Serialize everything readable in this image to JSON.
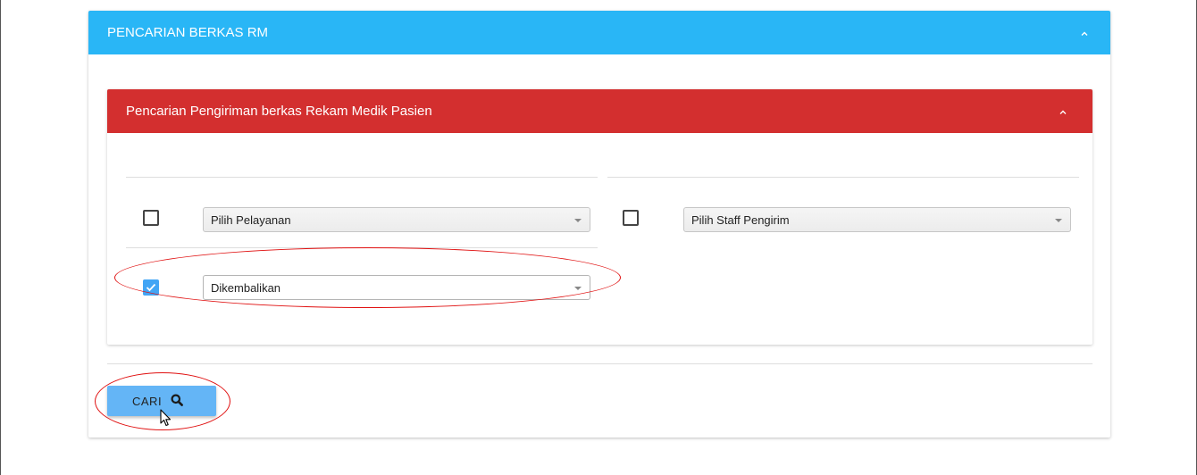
{
  "outer_panel": {
    "title": "PENCARIAN BERKAS RM",
    "collapse_icon": "chevron-up-icon"
  },
  "inner_panel": {
    "title": "Pencarian Pengiriman berkas Rekam Medik Pasien",
    "collapse_icon": "chevron-up-icon"
  },
  "filters": {
    "pelayanan": {
      "checked": false,
      "selected": "Pilih Pelayanan"
    },
    "staff": {
      "checked": false,
      "selected": "Pilih Staff Pengirim"
    },
    "status": {
      "checked": true,
      "selected": "Dikembalikan"
    }
  },
  "search_button": {
    "label": "CARI",
    "icon": "search-icon"
  },
  "colors": {
    "outer_header": "#29b6f6",
    "inner_header": "#d32f2f",
    "button": "#64b5f6",
    "checkbox_checked": "#42a5f5",
    "annotation": "#e01010"
  }
}
